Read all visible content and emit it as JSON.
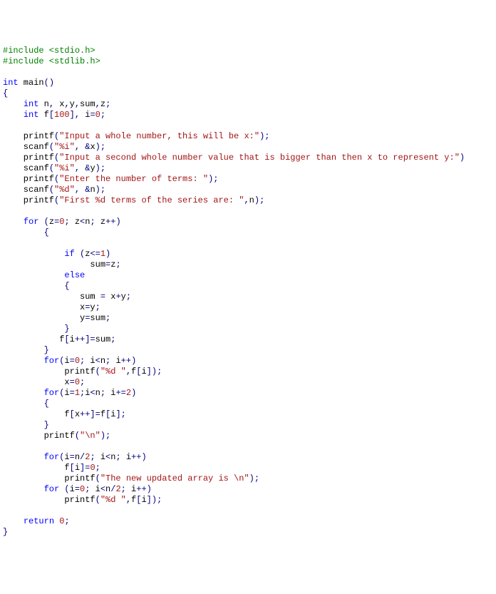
{
  "lines": [
    {
      "tokens": [
        {
          "cls": "pp",
          "t": "#include <stdio.h>"
        }
      ]
    },
    {
      "tokens": [
        {
          "cls": "pp",
          "t": "#include <stdlib.h>"
        }
      ]
    },
    {
      "tokens": [
        {
          "cls": "",
          "t": ""
        }
      ]
    },
    {
      "tokens": [
        {
          "cls": "kw",
          "t": "int"
        },
        {
          "cls": "",
          "t": " main"
        },
        {
          "cls": "pn",
          "t": "()"
        }
      ]
    },
    {
      "tokens": [
        {
          "cls": "brace",
          "t": "{"
        }
      ]
    },
    {
      "tokens": [
        {
          "cls": "",
          "t": "    "
        },
        {
          "cls": "kw",
          "t": "int"
        },
        {
          "cls": "",
          "t": " n"
        },
        {
          "cls": "op",
          "t": ","
        },
        {
          "cls": "",
          "t": " x"
        },
        {
          "cls": "op",
          "t": ","
        },
        {
          "cls": "",
          "t": "y"
        },
        {
          "cls": "op",
          "t": ","
        },
        {
          "cls": "",
          "t": "sum"
        },
        {
          "cls": "op",
          "t": ","
        },
        {
          "cls": "",
          "t": "z"
        },
        {
          "cls": "op",
          "t": ";"
        }
      ]
    },
    {
      "tokens": [
        {
          "cls": "",
          "t": "    "
        },
        {
          "cls": "kw",
          "t": "int"
        },
        {
          "cls": "",
          "t": " f"
        },
        {
          "cls": "op",
          "t": "["
        },
        {
          "cls": "num",
          "t": "100"
        },
        {
          "cls": "op",
          "t": "],"
        },
        {
          "cls": "",
          "t": " i"
        },
        {
          "cls": "op",
          "t": "="
        },
        {
          "cls": "num",
          "t": "0"
        },
        {
          "cls": "op",
          "t": ";"
        }
      ]
    },
    {
      "tokens": [
        {
          "cls": "",
          "t": ""
        }
      ]
    },
    {
      "tokens": [
        {
          "cls": "",
          "t": "    printf"
        },
        {
          "cls": "pn",
          "t": "("
        },
        {
          "cls": "str",
          "t": "\"Input a whole number, this will be x:\""
        },
        {
          "cls": "pn",
          "t": ")"
        },
        {
          "cls": "op",
          "t": ";"
        }
      ]
    },
    {
      "tokens": [
        {
          "cls": "",
          "t": "    scanf"
        },
        {
          "cls": "pn",
          "t": "("
        },
        {
          "cls": "str",
          "t": "\"%i\""
        },
        {
          "cls": "op",
          "t": ", &"
        },
        {
          "cls": "",
          "t": "x"
        },
        {
          "cls": "pn",
          "t": ")"
        },
        {
          "cls": "op",
          "t": ";"
        }
      ]
    },
    {
      "tokens": [
        {
          "cls": "",
          "t": "    printf"
        },
        {
          "cls": "pn",
          "t": "("
        },
        {
          "cls": "str",
          "t": "\"Input a second whole number value that is bigger than then x to represent y:\""
        },
        {
          "cls": "pn",
          "t": ")"
        }
      ]
    },
    {
      "tokens": [
        {
          "cls": "",
          "t": "    scanf"
        },
        {
          "cls": "pn",
          "t": "("
        },
        {
          "cls": "str",
          "t": "\"%i\""
        },
        {
          "cls": "op",
          "t": ", &"
        },
        {
          "cls": "",
          "t": "y"
        },
        {
          "cls": "pn",
          "t": ")"
        },
        {
          "cls": "op",
          "t": ";"
        }
      ]
    },
    {
      "tokens": [
        {
          "cls": "",
          "t": "    printf"
        },
        {
          "cls": "pn",
          "t": "("
        },
        {
          "cls": "str",
          "t": "\"Enter the number of terms: \""
        },
        {
          "cls": "pn",
          "t": ")"
        },
        {
          "cls": "op",
          "t": ";"
        }
      ]
    },
    {
      "tokens": [
        {
          "cls": "",
          "t": "    scanf"
        },
        {
          "cls": "pn",
          "t": "("
        },
        {
          "cls": "str",
          "t": "\"%d\""
        },
        {
          "cls": "op",
          "t": ", &"
        },
        {
          "cls": "",
          "t": "n"
        },
        {
          "cls": "pn",
          "t": ")"
        },
        {
          "cls": "op",
          "t": ";"
        }
      ]
    },
    {
      "tokens": [
        {
          "cls": "",
          "t": "    printf"
        },
        {
          "cls": "pn",
          "t": "("
        },
        {
          "cls": "str",
          "t": "\"First %d terms of the series are: \""
        },
        {
          "cls": "op",
          "t": ","
        },
        {
          "cls": "",
          "t": "n"
        },
        {
          "cls": "pn",
          "t": ")"
        },
        {
          "cls": "op",
          "t": ";"
        }
      ]
    },
    {
      "tokens": [
        {
          "cls": "",
          "t": ""
        }
      ]
    },
    {
      "tokens": [
        {
          "cls": "",
          "t": "    "
        },
        {
          "cls": "kw",
          "t": "for"
        },
        {
          "cls": "",
          "t": " "
        },
        {
          "cls": "pn",
          "t": "("
        },
        {
          "cls": "",
          "t": "z"
        },
        {
          "cls": "op",
          "t": "="
        },
        {
          "cls": "num",
          "t": "0"
        },
        {
          "cls": "op",
          "t": ";"
        },
        {
          "cls": "",
          "t": " z"
        },
        {
          "cls": "op",
          "t": "<"
        },
        {
          "cls": "",
          "t": "n"
        },
        {
          "cls": "op",
          "t": ";"
        },
        {
          "cls": "",
          "t": " z"
        },
        {
          "cls": "op",
          "t": "++"
        },
        {
          "cls": "pn",
          "t": ")"
        }
      ]
    },
    {
      "tokens": [
        {
          "cls": "",
          "t": "        "
        },
        {
          "cls": "brace",
          "t": "{"
        }
      ]
    },
    {
      "tokens": [
        {
          "cls": "",
          "t": ""
        }
      ]
    },
    {
      "tokens": [
        {
          "cls": "",
          "t": "            "
        },
        {
          "cls": "kw",
          "t": "if"
        },
        {
          "cls": "",
          "t": " "
        },
        {
          "cls": "pn",
          "t": "("
        },
        {
          "cls": "",
          "t": "z"
        },
        {
          "cls": "op",
          "t": "<="
        },
        {
          "cls": "num",
          "t": "1"
        },
        {
          "cls": "pn",
          "t": ")"
        }
      ]
    },
    {
      "tokens": [
        {
          "cls": "",
          "t": "                 sum"
        },
        {
          "cls": "op",
          "t": "="
        },
        {
          "cls": "",
          "t": "z"
        },
        {
          "cls": "op",
          "t": ";"
        }
      ]
    },
    {
      "tokens": [
        {
          "cls": "",
          "t": "            "
        },
        {
          "cls": "kw",
          "t": "else"
        }
      ]
    },
    {
      "tokens": [
        {
          "cls": "",
          "t": "            "
        },
        {
          "cls": "brace",
          "t": "{"
        }
      ]
    },
    {
      "tokens": [
        {
          "cls": "",
          "t": "               sum "
        },
        {
          "cls": "op",
          "t": "="
        },
        {
          "cls": "",
          "t": " x"
        },
        {
          "cls": "op",
          "t": "+"
        },
        {
          "cls": "",
          "t": "y"
        },
        {
          "cls": "op",
          "t": ";"
        }
      ]
    },
    {
      "tokens": [
        {
          "cls": "",
          "t": "               x"
        },
        {
          "cls": "op",
          "t": "="
        },
        {
          "cls": "",
          "t": "y"
        },
        {
          "cls": "op",
          "t": ";"
        }
      ]
    },
    {
      "tokens": [
        {
          "cls": "",
          "t": "               y"
        },
        {
          "cls": "op",
          "t": "="
        },
        {
          "cls": "",
          "t": "sum"
        },
        {
          "cls": "op",
          "t": ";"
        }
      ]
    },
    {
      "tokens": [
        {
          "cls": "",
          "t": "            "
        },
        {
          "cls": "brace",
          "t": "}"
        }
      ]
    },
    {
      "tokens": [
        {
          "cls": "",
          "t": "           f"
        },
        {
          "cls": "op",
          "t": "["
        },
        {
          "cls": "",
          "t": "i"
        },
        {
          "cls": "op",
          "t": "++]="
        },
        {
          "cls": "",
          "t": "sum"
        },
        {
          "cls": "op",
          "t": ";"
        }
      ]
    },
    {
      "tokens": [
        {
          "cls": "",
          "t": "        "
        },
        {
          "cls": "brace",
          "t": "}"
        }
      ]
    },
    {
      "tokens": [
        {
          "cls": "",
          "t": "        "
        },
        {
          "cls": "kw",
          "t": "for"
        },
        {
          "cls": "pn",
          "t": "("
        },
        {
          "cls": "",
          "t": "i"
        },
        {
          "cls": "op",
          "t": "="
        },
        {
          "cls": "num",
          "t": "0"
        },
        {
          "cls": "op",
          "t": ";"
        },
        {
          "cls": "",
          "t": " i"
        },
        {
          "cls": "op",
          "t": "<"
        },
        {
          "cls": "",
          "t": "n"
        },
        {
          "cls": "op",
          "t": ";"
        },
        {
          "cls": "",
          "t": " i"
        },
        {
          "cls": "op",
          "t": "++"
        },
        {
          "cls": "pn",
          "t": ")"
        }
      ]
    },
    {
      "tokens": [
        {
          "cls": "",
          "t": "            printf"
        },
        {
          "cls": "pn",
          "t": "("
        },
        {
          "cls": "str",
          "t": "\"%d \""
        },
        {
          "cls": "op",
          "t": ","
        },
        {
          "cls": "",
          "t": "f"
        },
        {
          "cls": "op",
          "t": "["
        },
        {
          "cls": "",
          "t": "i"
        },
        {
          "cls": "op",
          "t": "]"
        },
        {
          "cls": "pn",
          "t": ")"
        },
        {
          "cls": "op",
          "t": ";"
        }
      ]
    },
    {
      "tokens": [
        {
          "cls": "",
          "t": "            x"
        },
        {
          "cls": "op",
          "t": "="
        },
        {
          "cls": "num",
          "t": "0"
        },
        {
          "cls": "op",
          "t": ";"
        }
      ]
    },
    {
      "tokens": [
        {
          "cls": "",
          "t": "        "
        },
        {
          "cls": "kw",
          "t": "for"
        },
        {
          "cls": "pn",
          "t": "("
        },
        {
          "cls": "",
          "t": "i"
        },
        {
          "cls": "op",
          "t": "="
        },
        {
          "cls": "num",
          "t": "1"
        },
        {
          "cls": "op",
          "t": ";"
        },
        {
          "cls": "",
          "t": "i"
        },
        {
          "cls": "op",
          "t": "<"
        },
        {
          "cls": "",
          "t": "n"
        },
        {
          "cls": "op",
          "t": ";"
        },
        {
          "cls": "",
          "t": " i"
        },
        {
          "cls": "op",
          "t": "+="
        },
        {
          "cls": "num",
          "t": "2"
        },
        {
          "cls": "pn",
          "t": ")"
        }
      ]
    },
    {
      "tokens": [
        {
          "cls": "",
          "t": "        "
        },
        {
          "cls": "brace",
          "t": "{"
        }
      ]
    },
    {
      "tokens": [
        {
          "cls": "",
          "t": "            f"
        },
        {
          "cls": "op",
          "t": "["
        },
        {
          "cls": "",
          "t": "x"
        },
        {
          "cls": "op",
          "t": "++]="
        },
        {
          "cls": "",
          "t": "f"
        },
        {
          "cls": "op",
          "t": "["
        },
        {
          "cls": "",
          "t": "i"
        },
        {
          "cls": "op",
          "t": "];"
        }
      ]
    },
    {
      "tokens": [
        {
          "cls": "",
          "t": "        "
        },
        {
          "cls": "brace",
          "t": "}"
        }
      ]
    },
    {
      "tokens": [
        {
          "cls": "",
          "t": "        printf"
        },
        {
          "cls": "pn",
          "t": "("
        },
        {
          "cls": "str",
          "t": "\"\\n\""
        },
        {
          "cls": "pn",
          "t": ")"
        },
        {
          "cls": "op",
          "t": ";"
        }
      ]
    },
    {
      "tokens": [
        {
          "cls": "",
          "t": ""
        }
      ]
    },
    {
      "tokens": [
        {
          "cls": "",
          "t": "        "
        },
        {
          "cls": "kw",
          "t": "for"
        },
        {
          "cls": "pn",
          "t": "("
        },
        {
          "cls": "",
          "t": "i"
        },
        {
          "cls": "op",
          "t": "="
        },
        {
          "cls": "",
          "t": "n"
        },
        {
          "cls": "op",
          "t": "/"
        },
        {
          "cls": "num",
          "t": "2"
        },
        {
          "cls": "op",
          "t": ";"
        },
        {
          "cls": "",
          "t": " i"
        },
        {
          "cls": "op",
          "t": "<"
        },
        {
          "cls": "",
          "t": "n"
        },
        {
          "cls": "op",
          "t": ";"
        },
        {
          "cls": "",
          "t": " i"
        },
        {
          "cls": "op",
          "t": "++"
        },
        {
          "cls": "pn",
          "t": ")"
        }
      ]
    },
    {
      "tokens": [
        {
          "cls": "",
          "t": "            f"
        },
        {
          "cls": "op",
          "t": "["
        },
        {
          "cls": "",
          "t": "i"
        },
        {
          "cls": "op",
          "t": "]="
        },
        {
          "cls": "num",
          "t": "0"
        },
        {
          "cls": "op",
          "t": ";"
        }
      ]
    },
    {
      "tokens": [
        {
          "cls": "",
          "t": "            printf"
        },
        {
          "cls": "pn",
          "t": "("
        },
        {
          "cls": "str",
          "t": "\"The new updated array is \\n\""
        },
        {
          "cls": "pn",
          "t": ")"
        },
        {
          "cls": "op",
          "t": ";"
        }
      ]
    },
    {
      "tokens": [
        {
          "cls": "",
          "t": "        "
        },
        {
          "cls": "kw",
          "t": "for"
        },
        {
          "cls": "",
          "t": " "
        },
        {
          "cls": "pn",
          "t": "("
        },
        {
          "cls": "",
          "t": "i"
        },
        {
          "cls": "op",
          "t": "="
        },
        {
          "cls": "num",
          "t": "0"
        },
        {
          "cls": "op",
          "t": ";"
        },
        {
          "cls": "",
          "t": " i"
        },
        {
          "cls": "op",
          "t": "<"
        },
        {
          "cls": "",
          "t": "n"
        },
        {
          "cls": "op",
          "t": "/"
        },
        {
          "cls": "num",
          "t": "2"
        },
        {
          "cls": "op",
          "t": ";"
        },
        {
          "cls": "",
          "t": " i"
        },
        {
          "cls": "op",
          "t": "++"
        },
        {
          "cls": "pn",
          "t": ")"
        }
      ]
    },
    {
      "tokens": [
        {
          "cls": "",
          "t": "            printf"
        },
        {
          "cls": "pn",
          "t": "("
        },
        {
          "cls": "str",
          "t": "\"%d \""
        },
        {
          "cls": "op",
          "t": ","
        },
        {
          "cls": "",
          "t": "f"
        },
        {
          "cls": "op",
          "t": "["
        },
        {
          "cls": "",
          "t": "i"
        },
        {
          "cls": "op",
          "t": "]"
        },
        {
          "cls": "pn",
          "t": ")"
        },
        {
          "cls": "op",
          "t": ";"
        }
      ]
    },
    {
      "tokens": [
        {
          "cls": "",
          "t": ""
        }
      ]
    },
    {
      "tokens": [
        {
          "cls": "",
          "t": "    "
        },
        {
          "cls": "kw",
          "t": "return"
        },
        {
          "cls": "",
          "t": " "
        },
        {
          "cls": "num",
          "t": "0"
        },
        {
          "cls": "op",
          "t": ";"
        }
      ]
    },
    {
      "tokens": [
        {
          "cls": "brace",
          "t": "}"
        }
      ]
    }
  ]
}
